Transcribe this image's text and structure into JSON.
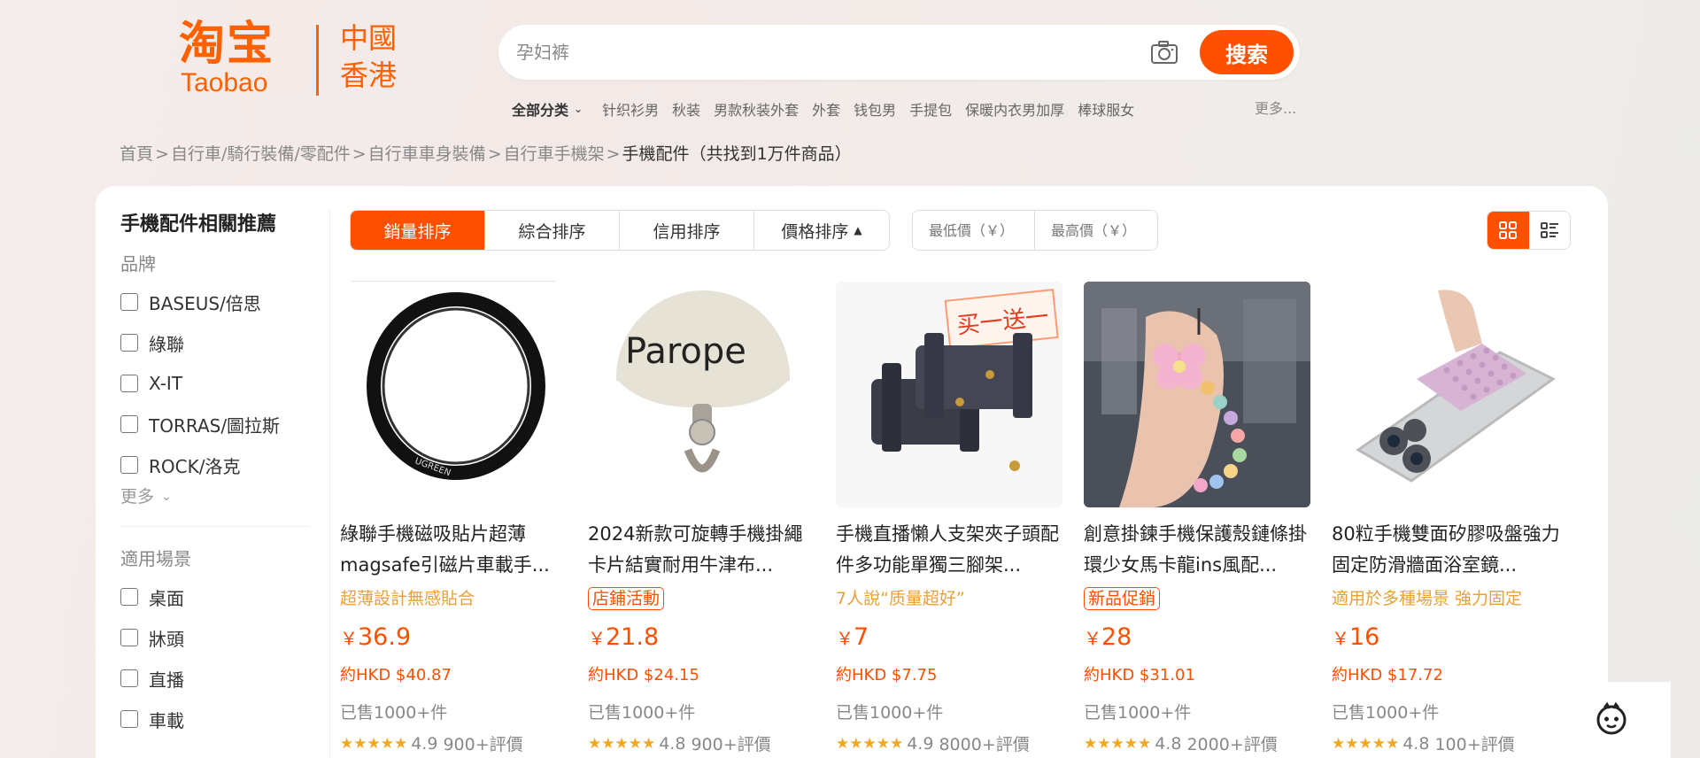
{
  "header": {
    "logo_cn": "淘宝",
    "logo_en": "Taobao",
    "region_line1": "中國",
    "region_line2": "香港",
    "search_placeholder": "孕妇裤",
    "search_button": "搜索",
    "category_label": "全部分类",
    "hot_words": [
      "针织衫男",
      "秋装",
      "男款秋装外套",
      "外套",
      "钱包男",
      "手提包",
      "保暖内衣男加厚",
      "棒球服女"
    ],
    "more": "更多..."
  },
  "breadcrumb": {
    "items": [
      "首頁",
      "自行車/騎行裝備/零配件",
      "自行車車身裝備",
      "自行車手機架"
    ],
    "separator": ">",
    "current": "手機配件",
    "count_text": "（共找到1万件商品）"
  },
  "sidebar": {
    "title": "手機配件相關推薦",
    "brand_heading": "品牌",
    "brands": [
      "BASEUS/倍思",
      "綠聯",
      "X-IT",
      "TORRAS/圖拉斯",
      "ROCK/洛克"
    ],
    "more_label": "更多",
    "scene_heading": "適用場景",
    "scenes": [
      "桌面",
      "牀頭",
      "直播",
      "車載"
    ]
  },
  "toolbar": {
    "sort_options": [
      "銷量排序",
      "綜合排序",
      "信用排序",
      "價格排序"
    ],
    "active_sort": "銷量排序",
    "min_price_placeholder": "最低價（￥）",
    "max_price_placeholder": "最高價（￥）",
    "view_modes": [
      "grid-view-icon",
      "list-view-icon"
    ]
  },
  "products": [
    {
      "title": "綠聯手機磁吸貼片超薄magsafe引磁片車載手...",
      "promo": "超薄設計無感貼合",
      "promo_boxed": false,
      "price_symbol": "￥",
      "price": "36.9",
      "hkd": "約HKD $40.87",
      "sold": "已售1000+件",
      "stars": "★★★★★",
      "rating": "4.9",
      "reviews": "900+評價",
      "image": "magsafe-ring-image"
    },
    {
      "title": "2024新款可旋轉手機掛繩卡片結實耐用牛津布...",
      "promo": "店鋪活動",
      "promo_boxed": true,
      "price_symbol": "￥",
      "price": "21.8",
      "hkd": "約HKD $24.15",
      "sold": "已售1000+件",
      "stars": "★★★★★",
      "rating": "4.8",
      "reviews": "900+評價",
      "image_text": "Parope",
      "image": "lanyard-card-image"
    },
    {
      "title": "手機直播懶人支架夾子頭配件多功能單獨三腳架...",
      "promo": "7人說“质量超好”",
      "promo_boxed": false,
      "price_symbol": "￥",
      "price": "7",
      "hkd": "約HKD $7.75",
      "sold": "已售1000+件",
      "stars": "★★★★★",
      "rating": "4.9",
      "reviews": "8000+評價",
      "image_text": "买一送一",
      "image": "phone-clip-image"
    },
    {
      "title": "創意掛鍊手機保護殼鏈條掛環少女馬卡龍ins風配...",
      "promo": "新品促銷",
      "promo_boxed": true,
      "price_symbol": "￥",
      "price": "28",
      "hkd": "約HKD $31.01",
      "sold": "已售1000+件",
      "stars": "★★★★★",
      "rating": "4.8",
      "reviews": "2000+評價",
      "image": "bead-chain-image"
    },
    {
      "title": "80粒手機雙面矽膠吸盤強力固定防滑牆面浴室鏡...",
      "promo": "適用於多種場景 強力固定",
      "promo_boxed": false,
      "price_symbol": "￥",
      "price": "16",
      "hkd": "約HKD $17.72",
      "sold": "已售1000+件",
      "stars": "★★★★★",
      "rating": "4.8",
      "reviews": "100+評價",
      "image": "suction-pad-image"
    }
  ],
  "colors": {
    "brand": "#ff5000",
    "promo_yellow": "#e8a13a",
    "star": "#f5a623"
  }
}
